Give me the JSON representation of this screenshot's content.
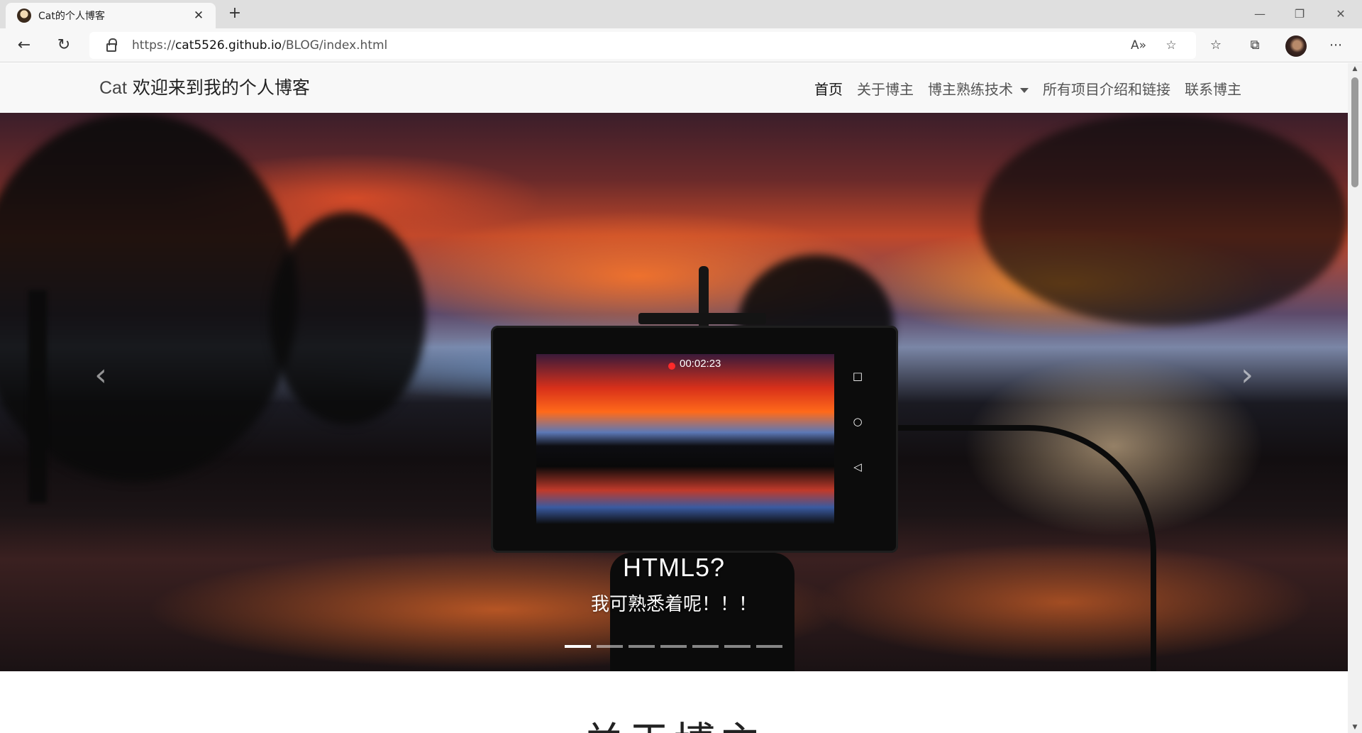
{
  "browser": {
    "tab_title": "Cat的个人博客",
    "tab_close": "✕",
    "new_tab": "+",
    "url_prefix": "https://",
    "url_host": "cat5526.github.io",
    "url_path": "/BLOG/index.html",
    "window": {
      "minimize": "—",
      "restore": "❐",
      "close": "✕"
    }
  },
  "navbar": {
    "brand_en": "Cat",
    "brand_cn": "欢迎来到我的个人博客",
    "links": [
      {
        "label": "首页"
      },
      {
        "label": "关于博主"
      },
      {
        "label": "博主熟练技术"
      },
      {
        "label": "所有项目介绍和链接"
      },
      {
        "label": "联系博主"
      }
    ]
  },
  "carousel": {
    "prev": "‹",
    "next": "›",
    "screen_time": "00:02:23",
    "caption_title": "HTML5?",
    "caption_sub": "我可熟悉着呢！！！",
    "slide_count": 7,
    "active_index": 0
  },
  "section": {
    "title": "关于博主"
  },
  "colors": {
    "navbar_bg": "#f8f8f8",
    "accent": "#ffffff"
  }
}
